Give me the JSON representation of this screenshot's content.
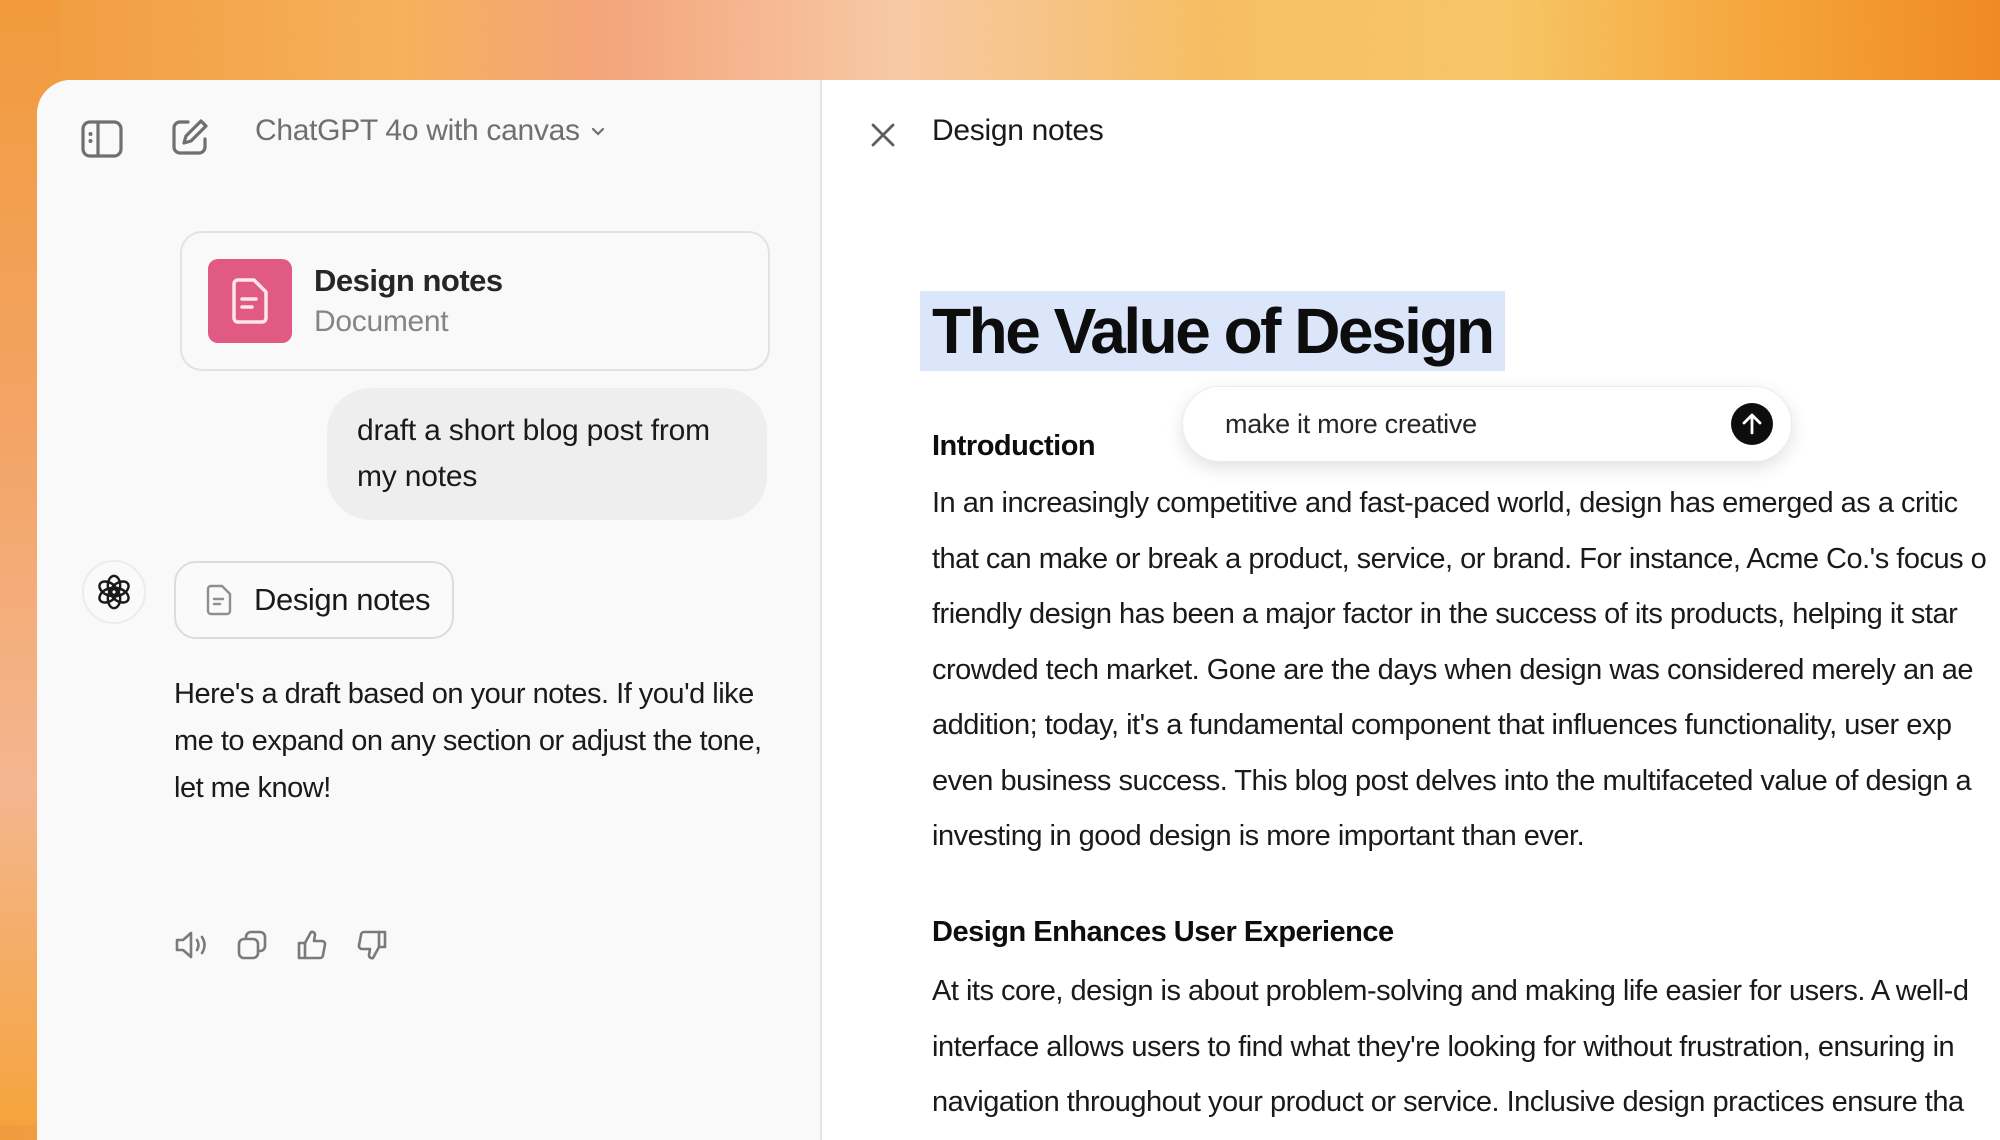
{
  "header": {
    "model_label": "ChatGPT 4o with canvas",
    "icons": {
      "sidebar_toggle": "sidebar-toggle-icon",
      "new_chat": "new-chat-icon",
      "model_dropdown": "chevron-down-icon"
    }
  },
  "chat": {
    "document_card": {
      "title": "Design notes",
      "subtitle": "Document",
      "icon": "document-icon",
      "accent_color": "#e05a84"
    },
    "user_message": {
      "line1": "draft a short blog post from",
      "line2": "my notes"
    },
    "assistant": {
      "avatar_icon": "openai-logo-icon",
      "doc_chip_label": "Design notes",
      "message": "Here's a draft based on your notes. If you'd like me to expand on any section or adjust the tone, let me know!",
      "actions": [
        {
          "name": "read-aloud",
          "icon": "speaker-icon"
        },
        {
          "name": "copy",
          "icon": "copy-icon"
        },
        {
          "name": "thumbs-up",
          "icon": "thumbs-up-icon"
        },
        {
          "name": "thumbs-down",
          "icon": "thumbs-down-icon"
        }
      ]
    }
  },
  "canvas": {
    "title": "Design notes",
    "close_icon": "close-icon",
    "inline_prompt": {
      "value": "make it more creative",
      "send_icon": "arrow-up-icon"
    },
    "document": {
      "heading": "The Value of Design",
      "highlight_color": "#dce6fb",
      "sections": [
        {
          "heading": "Introduction",
          "lines": [
            "In an increasingly competitive and fast-paced world, design has emerged as a critic",
            "that can make or break a product, service, or brand. For instance, Acme Co.'s focus o",
            "friendly design has been a major factor in the success of its products, helping it star",
            "crowded tech market. Gone are the days when design was considered merely an ae",
            "addition; today, it's a fundamental component that influences functionality, user exp",
            "even business success. This blog post delves into the multifaceted value of design a",
            "investing in good design is more important than ever."
          ]
        },
        {
          "heading": "Design Enhances User Experience",
          "lines": [
            "At its core, design is about problem-solving and making life easier for users. A well-d",
            "interface allows users to find what they're looking for without frustration, ensuring in",
            "navigation throughout your product or service. Inclusive design practices ensure tha"
          ]
        }
      ]
    }
  }
}
